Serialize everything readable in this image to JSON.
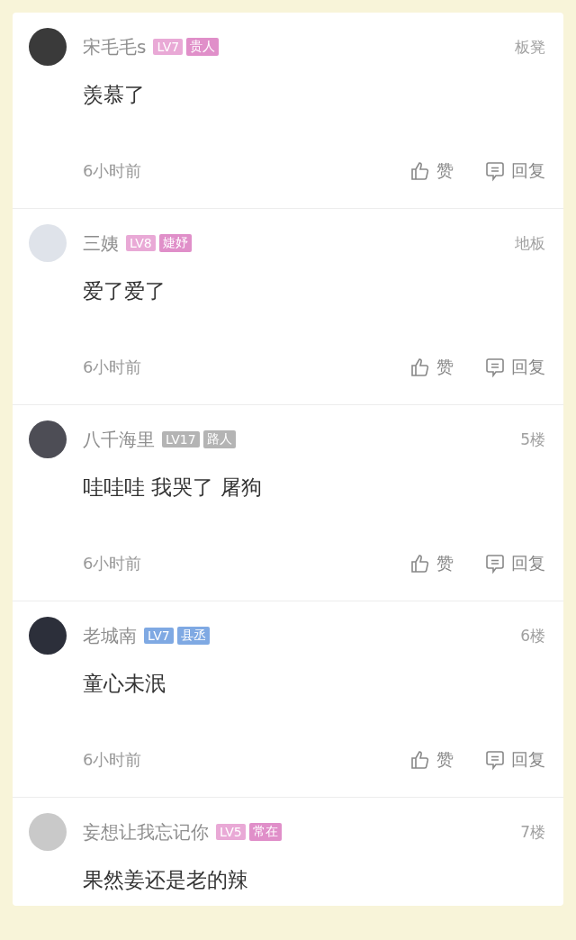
{
  "comments": [
    {
      "name": "宋毛毛s",
      "badges": [
        {
          "text": "LV7",
          "color": "#e9a9d6"
        },
        {
          "text": "贵人",
          "color": "#e08fc9"
        }
      ],
      "floor": "板凳",
      "text": "羡慕了",
      "time": "6小时前",
      "like": "赞",
      "reply": "回复"
    },
    {
      "name": "三姨",
      "badges": [
        {
          "text": "LV8",
          "color": "#e9a9d6"
        },
        {
          "text": "婕妤",
          "color": "#e08fc9"
        }
      ],
      "floor": "地板",
      "text": "爱了爱了",
      "time": "6小时前",
      "like": "赞",
      "reply": "回复"
    },
    {
      "name": "八千海里",
      "badges": [
        {
          "text": "LV17",
          "color": "#b4b4b4"
        },
        {
          "text": "路人",
          "color": "#b4b4b4"
        }
      ],
      "floor": "5楼",
      "text": "哇哇哇 我哭了 屠狗",
      "time": "6小时前",
      "like": "赞",
      "reply": "回复"
    },
    {
      "name": "老城南",
      "badges": [
        {
          "text": "LV7",
          "color": "#7fa9e3"
        },
        {
          "text": "县丞",
          "color": "#7fa9e3"
        }
      ],
      "floor": "6楼",
      "text": "童心未泯",
      "time": "6小时前",
      "like": "赞",
      "reply": "回复"
    },
    {
      "name": "妄想让我忘记你",
      "badges": [
        {
          "text": "LV5",
          "color": "#e9a9d6"
        },
        {
          "text": "常在",
          "color": "#e08fc9"
        }
      ],
      "floor": "7楼",
      "text": "果然姜还是老的辣"
    }
  ]
}
